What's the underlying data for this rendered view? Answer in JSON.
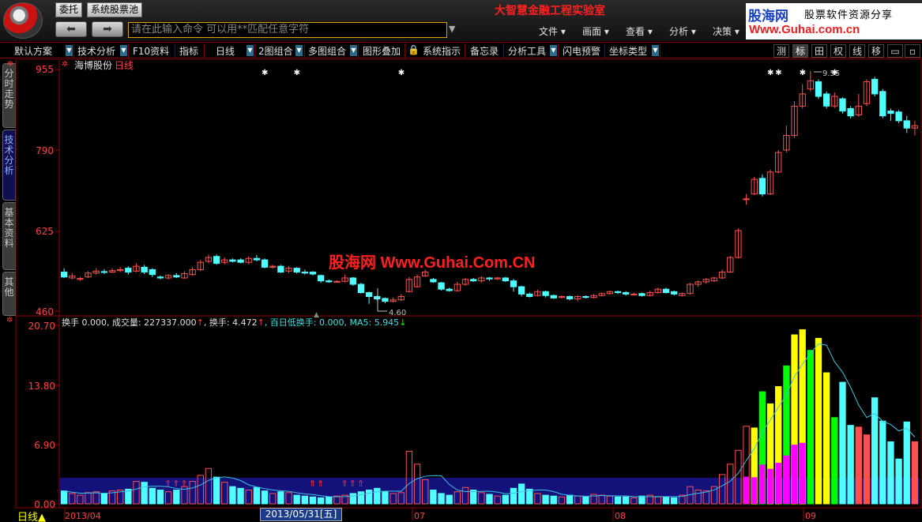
{
  "top": {
    "buttons": {
      "entrust": "委托",
      "stock_pool": "系统股票池"
    },
    "command_placeholder": "请在此输入命令   可以用**匹配任意字符",
    "lab_title": "大智慧金融工程实验室",
    "menus": [
      "文件",
      "画面",
      "查看",
      "分析",
      "决策"
    ],
    "brand": {
      "name": "股海网",
      "slogan": "股票软件资源分享",
      "url": "Www.Guhai.com.cn"
    }
  },
  "toolbar": {
    "items": [
      "默认方案",
      "技术分析",
      "F10资料",
      "指标",
      "日线",
      "2图组合",
      "多图组合",
      "图形叠加",
      "系统指示",
      "备忘录",
      "分析工具",
      "闪电预警",
      "坐标类型"
    ],
    "right_buttons": [
      "测",
      "标",
      "田",
      "权",
      "线",
      "移",
      "▭",
      "▫"
    ]
  },
  "left_tabs": [
    "分时走势",
    "技术分析",
    "基本资料",
    "其他"
  ],
  "stock": {
    "name": "海博股份",
    "period": "日线"
  },
  "watermark": "股海网 Www.Guhai.Com.CN",
  "price_axis": [
    "955",
    "790",
    "625",
    "460"
  ],
  "volume_axis": [
    "20.70",
    "13.80",
    "6.90",
    "0.00"
  ],
  "annotations": {
    "low": "4.60",
    "high": "9.55"
  },
  "indicator_label": {
    "part1": "换手 0.000, 成交量: 227337.000",
    "arrow1": "↑",
    "part2": ", 换手: 4.472",
    "arrow2": "↑",
    "part3": ", 百日低换手: 0.000, MA5: 5.945",
    "arrow3": "↓"
  },
  "date_axis": {
    "labels": [
      "2013/04",
      "07",
      "08",
      "09"
    ],
    "badge": "2013/05/31[五]",
    "period_label": "日线▲"
  },
  "colors": {
    "up": "#ff5050",
    "down": "#50ffff",
    "grid": "#8b0000",
    "axis_text": "#ff4040",
    "volume_band": "#12127a",
    "highlight": "#00ff00",
    "yellow": "#ffff00",
    "magenta": "#ff00ff"
  },
  "chart_data": {
    "type": "candlestick",
    "price_unit": "cents",
    "price_ylim": [
      460,
      955
    ],
    "volume_ylim": [
      0,
      20.7
    ],
    "bars": [
      [
        540,
        530,
        548,
        528
      ],
      [
        528,
        532,
        538,
        525
      ],
      [
        525,
        527,
        530,
        522
      ],
      [
        530,
        538,
        542,
        528
      ],
      [
        538,
        542,
        548,
        535
      ],
      [
        541,
        540,
        546,
        536
      ],
      [
        540,
        543,
        548,
        538
      ],
      [
        543,
        545,
        550,
        540
      ],
      [
        548,
        540,
        552,
        535
      ],
      [
        542,
        552,
        558,
        540
      ],
      [
        550,
        540,
        555,
        536
      ],
      [
        545,
        535,
        548,
        530
      ],
      [
        530,
        528,
        533,
        525
      ],
      [
        528,
        533,
        536,
        525
      ],
      [
        533,
        530,
        538,
        528
      ],
      [
        528,
        537,
        542,
        526
      ],
      [
        535,
        545,
        550,
        532
      ],
      [
        545,
        560,
        565,
        542
      ],
      [
        562,
        570,
        576,
        558
      ],
      [
        572,
        558,
        576,
        555
      ],
      [
        560,
        565,
        570,
        556
      ],
      [
        565,
        562,
        568,
        560
      ],
      [
        565,
        560,
        568,
        558
      ],
      [
        560,
        568,
        572,
        556
      ],
      [
        568,
        565,
        575,
        562
      ],
      [
        565,
        550,
        568,
        548
      ],
      [
        550,
        552,
        555,
        547
      ],
      [
        552,
        540,
        555,
        538
      ],
      [
        542,
        548,
        552,
        538
      ],
      [
        548,
        540,
        550,
        537
      ],
      [
        540,
        538,
        545,
        535
      ],
      [
        540,
        536,
        542,
        533
      ],
      [
        533,
        522,
        535,
        518
      ],
      [
        522,
        520,
        525,
        518
      ],
      [
        520,
        521,
        523,
        518
      ],
      [
        521,
        528,
        535,
        519
      ],
      [
        528,
        515,
        530,
        512
      ],
      [
        515,
        498,
        518,
        496
      ],
      [
        498,
        490,
        500,
        475
      ],
      [
        490,
        485,
        492,
        482
      ],
      [
        486,
        480,
        488,
        476
      ],
      [
        480,
        483,
        488,
        478
      ],
      [
        483,
        490,
        495,
        481
      ],
      [
        500,
        525,
        530,
        498
      ],
      [
        510,
        530,
        535,
        508
      ],
      [
        532,
        540,
        545,
        530
      ],
      [
        525,
        520,
        528,
        518
      ],
      [
        518,
        505,
        520,
        502
      ],
      [
        505,
        502,
        508,
        500
      ],
      [
        502,
        515,
        520,
        500
      ],
      [
        515,
        525,
        528,
        512
      ],
      [
        525,
        522,
        528,
        520
      ],
      [
        522,
        528,
        532,
        518
      ],
      [
        528,
        526,
        530,
        522
      ],
      [
        526,
        528,
        530,
        524
      ],
      [
        528,
        522,
        530,
        520
      ],
      [
        522,
        510,
        526,
        500
      ],
      [
        510,
        495,
        512,
        490
      ],
      [
        495,
        490,
        498,
        488
      ],
      [
        492,
        500,
        504,
        490
      ],
      [
        500,
        492,
        502,
        488
      ],
      [
        492,
        487,
        494,
        485
      ],
      [
        488,
        490,
        492,
        486
      ],
      [
        490,
        485,
        492,
        482
      ],
      [
        485,
        490,
        493,
        480
      ],
      [
        490,
        488,
        492,
        486
      ],
      [
        488,
        492,
        495,
        486
      ],
      [
        492,
        496,
        498,
        490
      ],
      [
        496,
        500,
        502,
        494
      ],
      [
        500,
        498,
        502,
        495
      ],
      [
        498,
        495,
        501,
        492
      ],
      [
        495,
        495,
        498,
        492
      ],
      [
        496,
        492,
        498,
        490
      ],
      [
        492,
        498,
        502,
        490
      ],
      [
        498,
        505,
        508,
        496
      ],
      [
        505,
        498,
        508,
        496
      ],
      [
        500,
        495,
        502,
        492
      ],
      [
        492,
        496,
        498,
        490
      ],
      [
        496,
        515,
        518,
        494
      ],
      [
        515,
        520,
        523,
        510
      ],
      [
        520,
        525,
        528,
        516
      ],
      [
        522,
        528,
        530,
        520
      ],
      [
        528,
        540,
        545,
        526
      ],
      [
        540,
        570,
        573,
        538
      ],
      [
        570,
        625,
        630,
        568
      ],
      [
        690,
        690,
        700,
        678
      ],
      [
        700,
        730,
        735,
        698
      ],
      [
        732,
        700,
        740,
        695
      ],
      [
        700,
        745,
        750,
        698
      ],
      [
        745,
        785,
        790,
        742
      ],
      [
        790,
        820,
        840,
        785
      ],
      [
        820,
        880,
        890,
        815
      ],
      [
        880,
        905,
        925,
        875
      ],
      [
        915,
        932,
        952,
        910
      ],
      [
        930,
        900,
        935,
        895
      ],
      [
        905,
        880,
        910,
        875
      ],
      [
        880,
        900,
        908,
        876
      ],
      [
        895,
        870,
        898,
        865
      ],
      [
        875,
        860,
        880,
        855
      ],
      [
        862,
        880,
        905,
        858
      ],
      [
        885,
        930,
        935,
        880
      ],
      [
        935,
        905,
        940,
        900
      ],
      [
        910,
        860,
        915,
        855
      ],
      [
        870,
        865,
        875,
        850
      ],
      [
        868,
        850,
        872,
        845
      ],
      [
        850,
        835,
        860,
        825
      ],
      [
        835,
        840,
        850,
        820
      ]
    ],
    "volume": [
      1.5,
      1.2,
      1.0,
      1.3,
      1.4,
      1.2,
      1.5,
      1.6,
      1.7,
      2.6,
      2.5,
      1.8,
      1.6,
      1.4,
      1.6,
      2.0,
      2.6,
      3.3,
      4.1,
      3.1,
      2.5,
      2.0,
      1.8,
      1.6,
      1.9,
      1.5,
      1.2,
      1.4,
      1.3,
      1.0,
      0.9,
      0.8,
      0.7,
      0.8,
      0.9,
      1.0,
      1.2,
      1.4,
      1.6,
      1.8,
      1.4,
      1.2,
      1.3,
      6.1,
      4.6,
      2.8,
      1.6,
      1.2,
      1.0,
      1.4,
      1.9,
      1.6,
      1.3,
      1.1,
      0.9,
      1.0,
      1.8,
      2.3,
      1.7,
      1.2,
      1.0,
      0.9,
      0.8,
      1.0,
      0.9,
      0.8,
      1.1,
      1.0,
      0.9,
      0.8,
      0.8,
      0.7,
      0.9,
      1.0,
      0.8,
      0.8,
      0.7,
      1.0,
      2.0,
      1.6,
      1.5,
      2.0,
      3.4,
      4.6,
      6.2,
      9.0,
      8.8,
      13.0,
      11.6,
      13.6,
      16.0,
      19.6,
      20.2,
      17.8,
      19.2,
      15.2,
      10.0,
      14.1,
      9.1,
      8.9,
      8.0,
      12.3,
      9.6,
      7.2,
      5.2,
      9.5,
      7.2
    ]
  }
}
